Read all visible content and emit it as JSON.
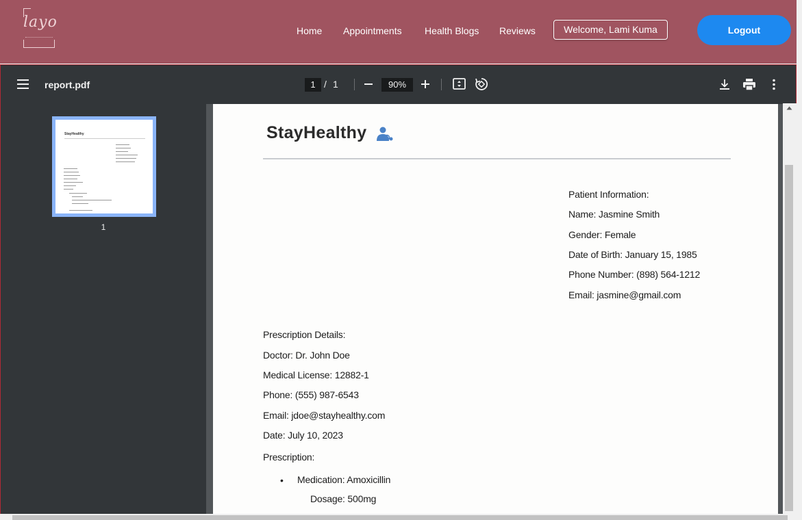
{
  "site": {
    "logo_text": "layo",
    "nav": [
      "Home",
      "Appointments",
      "Health Blogs",
      "Reviews"
    ],
    "welcome": "Welcome, Lami Kuma",
    "logout": "Logout",
    "colors": {
      "header_bg": "#a05460",
      "logout_bg": "#1d89f0"
    }
  },
  "viewer": {
    "title": "report.pdf",
    "page_current": "1",
    "page_sep": "/",
    "page_total": "1",
    "zoom": "90%",
    "thumbnail_label": "1",
    "icons": [
      "menu-icon",
      "zoom-out-icon",
      "zoom-in-icon",
      "fit-page-icon",
      "rotate-icon",
      "download-icon",
      "print-icon",
      "more-options-icon"
    ]
  },
  "document": {
    "brand": "StayHealthy",
    "patient": {
      "heading": "Patient Information:",
      "name": "Name: Jasmine Smith",
      "gender": "Gender: Female",
      "dob": "Date of Birth: January 15, 1985",
      "phone": "Phone Number: (898) 564-1212",
      "email": "Email: jasmine@gmail.com"
    },
    "prescription": {
      "heading": "Prescription Details:",
      "doctor": "Doctor: Dr. John Doe",
      "license": "Medical License: 12882-1",
      "phone": "Phone: (555) 987-6543",
      "email": "Email: jdoe@stayhealthy.com",
      "date": "Date: July 10, 2023",
      "label": "Prescription:",
      "bullet": "•",
      "medication": "Medication: Amoxicillin",
      "dosage": "Dosage: 500mg"
    }
  }
}
